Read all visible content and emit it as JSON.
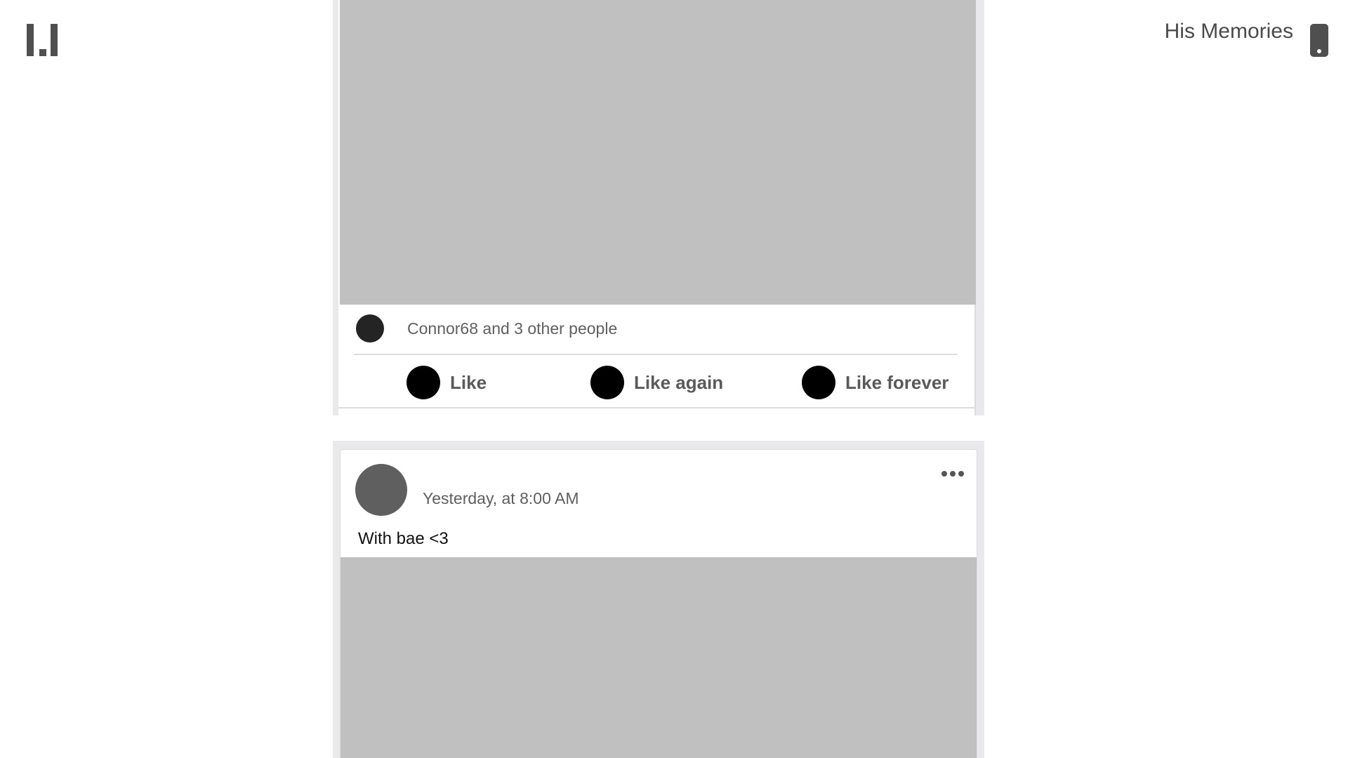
{
  "header": {
    "logo_icon": "logo-icon",
    "title": "His Memories",
    "phone_icon": "phone-icon"
  },
  "posts": [
    {
      "photo": "photo-placeholder",
      "likes_summary": "Connor68 and 3 other people",
      "actions": [
        {
          "label": "Like",
          "icon": "circle-icon"
        },
        {
          "label": "Like again",
          "icon": "circle-icon"
        },
        {
          "label": "Like forever",
          "icon": "circle-icon"
        }
      ]
    },
    {
      "timestamp": "Yesterday, at 8:00 AM",
      "caption": "With bae <3",
      "more_icon": "more-options-icon",
      "photo": "photo-placeholder"
    }
  ],
  "colors": {
    "photo_placeholder": "#c0c0c0",
    "feed_background": "#e9e9ec",
    "icon_dark": "#4f4f4f",
    "action_icon": "#000000"
  }
}
